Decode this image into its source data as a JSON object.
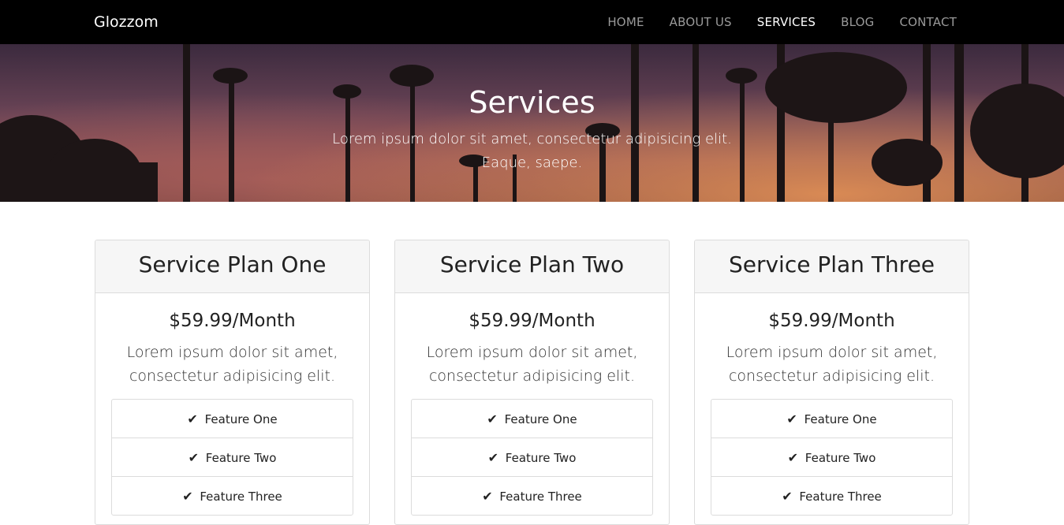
{
  "navbar": {
    "brand": "Glozzom",
    "items": [
      {
        "label": "HOME",
        "active": false
      },
      {
        "label": "ABOUT US",
        "active": false
      },
      {
        "label": "SERVICES",
        "active": true
      },
      {
        "label": "BLOG",
        "active": false
      },
      {
        "label": "CONTACT",
        "active": false
      }
    ]
  },
  "hero": {
    "title": "Services",
    "lead": "Lorem ipsum dolor sit amet, consectetur adipisicing elit. Eaque, saepe."
  },
  "plans": [
    {
      "name": "Service Plan One",
      "price": "$59.99/Month",
      "description": "Lorem ipsum dolor sit amet, consectetur adipisicing elit.",
      "features": [
        "Feature One",
        "Feature Two",
        "Feature Three"
      ]
    },
    {
      "name": "Service Plan Two",
      "price": "$59.99/Month",
      "description": "Lorem ipsum dolor sit amet, consectetur adipisicing elit.",
      "features": [
        "Feature One",
        "Feature Two",
        "Feature Three"
      ]
    },
    {
      "name": "Service Plan Three",
      "price": "$59.99/Month",
      "description": "Lorem ipsum dolor sit amet, consectetur adipisicing elit.",
      "features": [
        "Feature One",
        "Feature Two",
        "Feature Three"
      ]
    }
  ],
  "icons": {
    "feature_check": "check-icon"
  },
  "colors": {
    "navbar_bg": "#000000",
    "nav_active": "#ffffff",
    "nav_inactive": "#9a9a9a",
    "card_header_bg": "#f6f6f6",
    "border": "#dcdcdc"
  }
}
